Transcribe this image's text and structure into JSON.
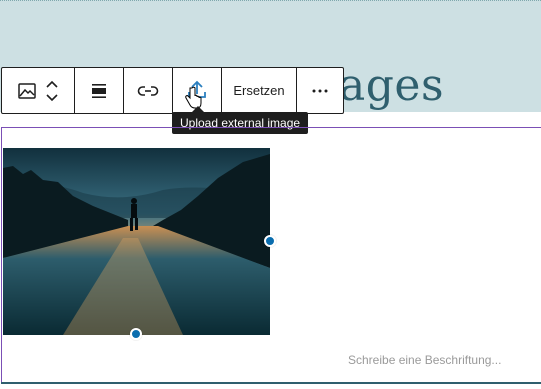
{
  "heading": {
    "visible_text": "ages"
  },
  "toolbar": {
    "items": [
      {
        "icon": "image-icon"
      },
      {
        "icon": "chevron-up-down-icon"
      },
      {
        "icon": "align-icon"
      },
      {
        "icon": "link-icon"
      },
      {
        "icon": "upload-icon"
      },
      {
        "label": "Ersetzen"
      },
      {
        "icon": "more-icon"
      }
    ],
    "replace_label": "Ersetzen"
  },
  "tooltip": {
    "text": "Upload external image"
  },
  "image_block": {
    "caption_placeholder": "Schreibe eine Beschriftung...",
    "image_alt": "Runner on a wet road at dusk"
  },
  "colors": {
    "header_band": "#cde0e3",
    "heading_text": "#2f5f6e",
    "accent_purple": "#7b4fb5",
    "resize_handle": "#0a6dae",
    "upload_icon": "#2b7fbf"
  }
}
